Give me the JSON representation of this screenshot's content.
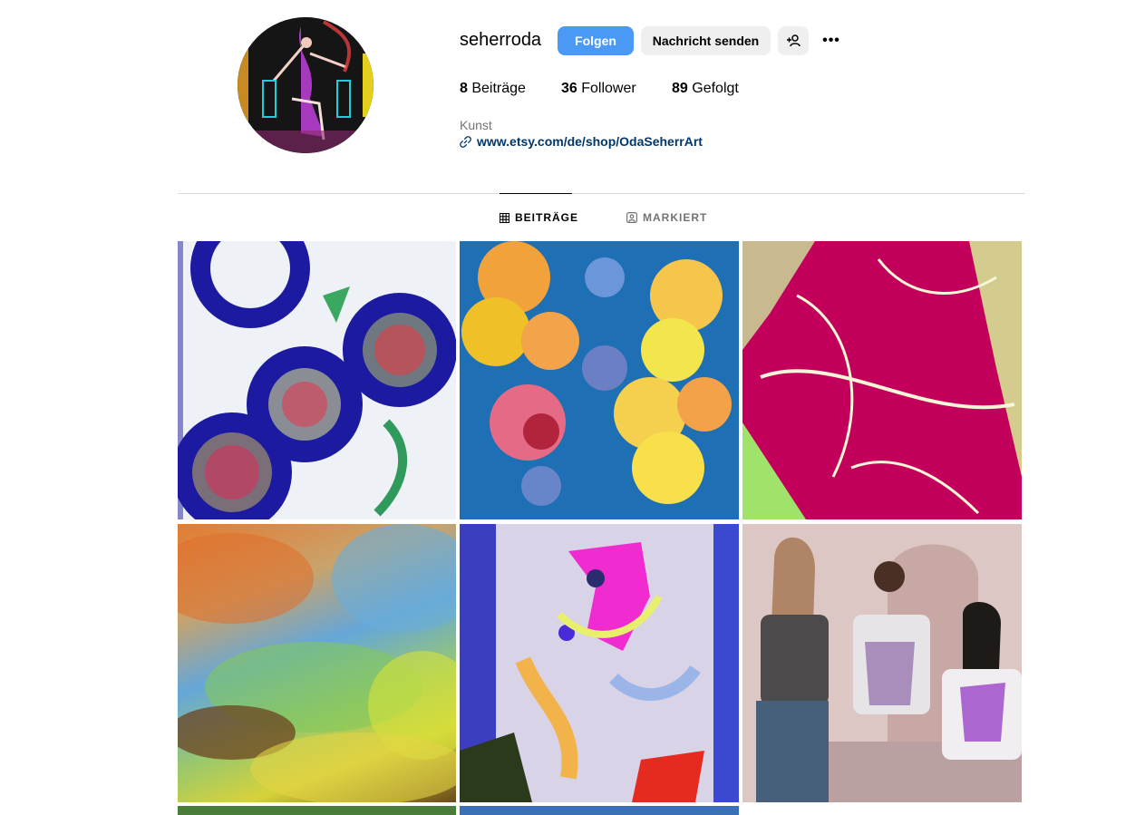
{
  "profile": {
    "username": "seherroda",
    "follow_label": "Folgen",
    "message_label": "Nachricht senden",
    "suggest_icon": "add-person-icon",
    "more_icon": "more-dots-icon",
    "more_glyph": "•••"
  },
  "stats": {
    "posts_count": "8",
    "posts_label": "Beiträge",
    "followers_count": "36",
    "followers_label": "Follower",
    "following_count": "89",
    "following_label": "Gefolgt"
  },
  "bio": {
    "category": "Kunst",
    "link": "www.etsy.com/de/shop/OdaSeherrArt"
  },
  "tabs": [
    {
      "label": "BEITRÄGE",
      "icon": "grid-icon",
      "active": true
    },
    {
      "label": "MARKIERT",
      "icon": "tagged-person-icon",
      "active": false
    }
  ],
  "colors": {
    "accent": "#4a9af5",
    "secondary_button": "#efefef",
    "link": "#00376b",
    "muted": "#737373"
  }
}
